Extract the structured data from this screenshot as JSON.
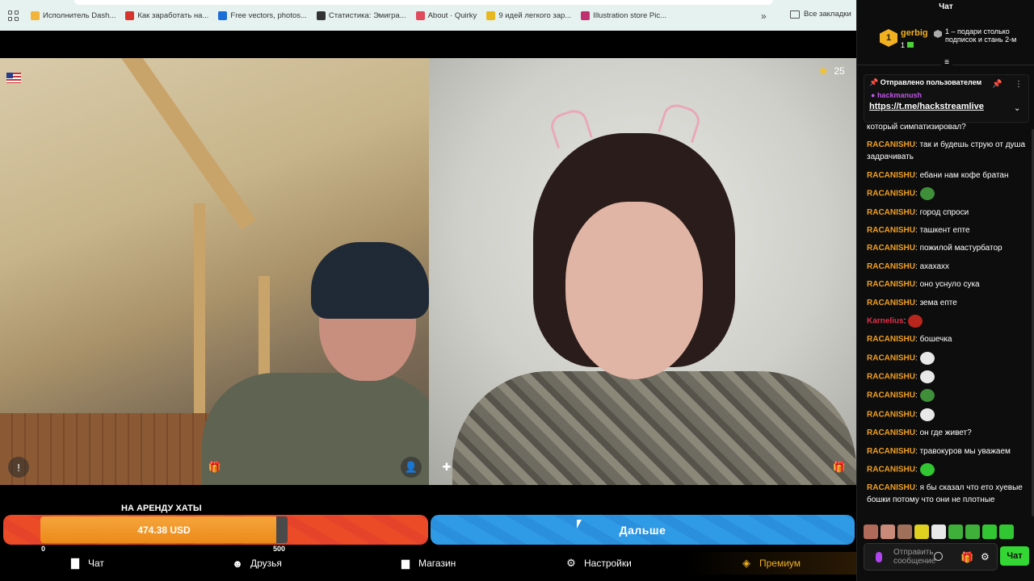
{
  "bookmarks": {
    "items": [
      {
        "label": "Исполнитель Dash...",
        "color": "#f2b53a"
      },
      {
        "label": "Как заработать на...",
        "color": "#d6342c"
      },
      {
        "label": "Free vectors, photos...",
        "color": "#1d6fd8"
      },
      {
        "label": "Статистика: Эмигра...",
        "color": "#333333"
      },
      {
        "label": "About · Quirky",
        "color": "#e04a5a"
      },
      {
        "label": "9 идей легкого зар...",
        "color": "#e8b820"
      },
      {
        "label": "Illustration store Pic...",
        "color": "#c03070"
      }
    ],
    "more": "»",
    "all": "Все закладки"
  },
  "video": {
    "stars_count": "25"
  },
  "goal": {
    "title": "НА АРЕНДУ ХАТЫ",
    "amount": "474.38 USD",
    "min": "0",
    "max": "500",
    "progress": 0.9488
  },
  "next_button": "Дальше",
  "nav": {
    "chat": "Чат",
    "friends": "Друзья",
    "shop": "Магазин",
    "settings": "Настройки",
    "premium": "Премиум"
  },
  "chat": {
    "title": "Чат",
    "top_user": {
      "rank": "1",
      "name": "gerbig",
      "level": "1"
    },
    "gift_text": "1 – подари столько подписок и стань 2-м",
    "pinned": {
      "header": "Отправлено пользователем",
      "user": "hackmanush",
      "link": "https://t.me/hackstreamlive"
    },
    "messages": [
      {
        "nick": "",
        "text": "который симпатизировал?",
        "emote": ""
      },
      {
        "nick": "RACANISHU",
        "text": "так и будешь струю от душа задрачивать",
        "emote": ""
      },
      {
        "nick": "RACANISHU",
        "text": "ебани нам кофе братан",
        "emote": ""
      },
      {
        "nick": "RACANISHU",
        "text": "",
        "emote": "#3f8f3a"
      },
      {
        "nick": "RACANISHU",
        "text": "город спроси",
        "emote": ""
      },
      {
        "nick": "RACANISHU",
        "text": "ташкент епте",
        "emote": ""
      },
      {
        "nick": "RACANISHU",
        "text": "пожилой мастурбатор",
        "emote": ""
      },
      {
        "nick": "RACANISHU",
        "text": "ахахахх",
        "emote": ""
      },
      {
        "nick": "RACANISHU",
        "text": "оно уснуло сука",
        "emote": ""
      },
      {
        "nick": "RACANISHU",
        "text": "зема епте",
        "emote": ""
      },
      {
        "nick": "Karnelius",
        "text": "",
        "emote": "#b8261e",
        "red": true
      },
      {
        "nick": "RACANISHU",
        "text": "бошечка",
        "emote": ""
      },
      {
        "nick": "RACANISHU",
        "text": "",
        "emote": "#e8e8e8"
      },
      {
        "nick": "RACANISHU",
        "text": "",
        "emote": "#e8e8e8"
      },
      {
        "nick": "RACANISHU",
        "text": "",
        "emote": "#3f8f3a"
      },
      {
        "nick": "RACANISHU",
        "text": "",
        "emote": "#e8e8e8"
      },
      {
        "nick": "RACANISHU",
        "text": "он где живет?",
        "emote": ""
      },
      {
        "nick": "RACANISHU",
        "text": "травокуров мы уважаем",
        "emote": ""
      },
      {
        "nick": "RACANISHU",
        "text": "",
        "emote": "#33c633"
      },
      {
        "nick": "RACANISHU",
        "text": "я бы сказал что ето хуевые бошки потому что они не плотные",
        "emote": ""
      }
    ],
    "emote_bar": [
      "#b06a5a",
      "#c98a7a",
      "#a0705a",
      "#e0d020",
      "#e8e8e8",
      "#3fb03a",
      "#3fb03a",
      "#33c633",
      "#33c633"
    ],
    "input_placeholder": "Отправить сообщение",
    "send_label": "Чат"
  },
  "colors": {
    "goal_bar": "#ec4b28",
    "goal_fill": "#f5a53b",
    "next_button": "#2f9ae6",
    "send_button": "#33d633",
    "nick": "#f0a021"
  }
}
